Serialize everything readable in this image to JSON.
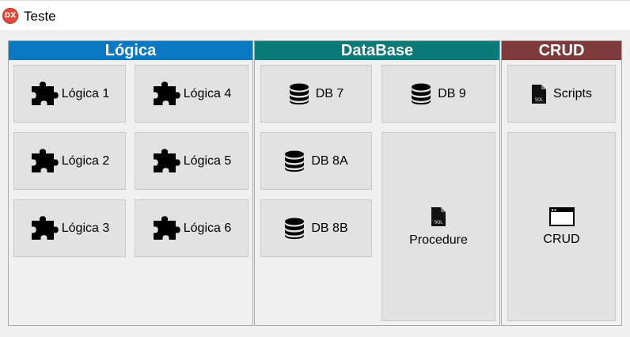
{
  "window": {
    "title": "Teste",
    "app_icon_text": "DX"
  },
  "colors": {
    "logica": "#0a78c2",
    "database": "#0a7a78",
    "crud": "#7d3b3b"
  },
  "groups": {
    "logica": {
      "header": "Lógica",
      "tiles": [
        {
          "label": "Lógica 1",
          "icon": "puzzle-icon"
        },
        {
          "label": "Lógica 4",
          "icon": "puzzle-icon"
        },
        {
          "label": "Lógica 2",
          "icon": "puzzle-icon"
        },
        {
          "label": "Lógica 5",
          "icon": "puzzle-icon"
        },
        {
          "label": "Lógica 3",
          "icon": "puzzle-icon"
        },
        {
          "label": "Lógica 6",
          "icon": "puzzle-icon"
        }
      ]
    },
    "database": {
      "header": "DataBase",
      "tiles": [
        {
          "label": "DB 7",
          "icon": "database-icon"
        },
        {
          "label": "DB 9",
          "icon": "database-icon"
        },
        {
          "label": "DB 8A",
          "icon": "database-icon"
        },
        {
          "label": "DB 8B",
          "icon": "database-icon"
        },
        {
          "label": "Procedure",
          "icon": "sql-file-icon"
        }
      ]
    },
    "crud": {
      "header": "CRUD",
      "tiles": [
        {
          "label": "Scripts",
          "icon": "sql-file-icon"
        },
        {
          "label": "CRUD",
          "icon": "window-icon"
        }
      ]
    }
  }
}
